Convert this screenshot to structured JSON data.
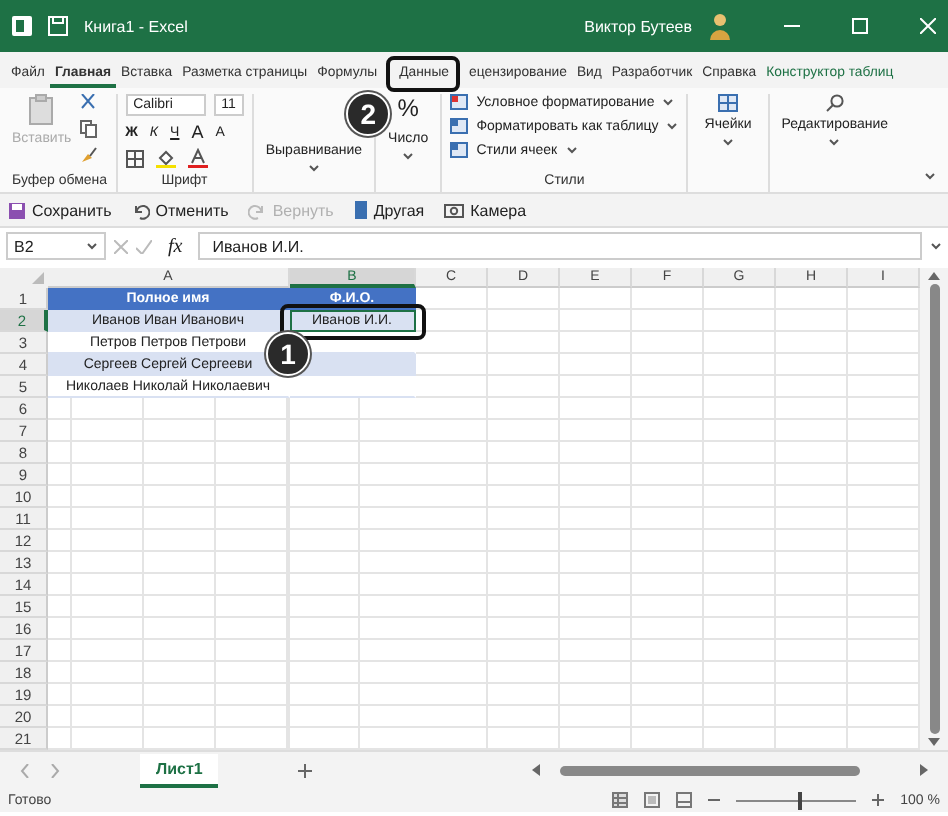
{
  "window": {
    "title": "Книга1 - Excel",
    "user": "Виктор Бутеев"
  },
  "tabs": [
    {
      "label": "Файл",
      "selected": false,
      "highlighted": false
    },
    {
      "label": "Главная",
      "selected": true,
      "highlighted": false
    },
    {
      "label": "Вставка",
      "selected": false,
      "highlighted": false
    },
    {
      "label": "Разметка страницы",
      "selected": false,
      "highlighted": false
    },
    {
      "label": "Формулы",
      "selected": false,
      "highlighted": false
    },
    {
      "label": "Данные",
      "selected": false,
      "highlighted": true,
      "callout": "2"
    },
    {
      "label": "ецензирование",
      "selected": false,
      "highlighted": false
    },
    {
      "label": "Вид",
      "selected": false,
      "highlighted": false
    },
    {
      "label": "Разработчик",
      "selected": false,
      "highlighted": false
    },
    {
      "label": "Справка",
      "selected": false,
      "highlighted": false
    },
    {
      "label": "Конструктор таблиц",
      "selected": false,
      "highlighted": false,
      "kind": "context"
    }
  ],
  "ribbon": {
    "clipboard": {
      "paste": "Вставить",
      "group": "Буфер обмена"
    },
    "font": {
      "name": "Calibri",
      "size": "11",
      "bold": "Ж",
      "italic": "К",
      "underline": "Ч",
      "grow": "A",
      "shrink": "A",
      "group": "Шрифт"
    },
    "alignment": "Выравнивание",
    "number": {
      "symbol": "%",
      "label": "Число"
    },
    "styles": {
      "items": [
        "Условное форматирование",
        "Форматировать как таблицу",
        "Стили ячеек"
      ],
      "group": "Стили"
    },
    "cells": "Ячейки",
    "editing": "Редактирование"
  },
  "quick_access": [
    {
      "label": "Сохранить",
      "disabled": false,
      "kind": "save"
    },
    {
      "label": "Отменить",
      "disabled": false,
      "kind": "undo"
    },
    {
      "label": "Вернуть",
      "disabled": true,
      "kind": "redo"
    },
    {
      "label": "Другая",
      "disabled": false,
      "kind": "other"
    },
    {
      "label": "Камера",
      "disabled": false,
      "kind": "camera"
    }
  ],
  "formula_bar": {
    "cell": "B2",
    "fx": "fx",
    "value": "Иванов И.И."
  },
  "sheet": {
    "columns": [
      {
        "label": "A",
        "selected": false
      },
      {
        "label": "B",
        "selected": true
      },
      {
        "label": "C",
        "selected": false
      },
      {
        "label": "D",
        "selected": false
      },
      {
        "label": "E",
        "selected": false
      },
      {
        "label": "F",
        "selected": false
      },
      {
        "label": "G",
        "selected": false
      },
      {
        "label": "H",
        "selected": false
      },
      {
        "label": "I",
        "selected": false
      }
    ],
    "rows": [
      {
        "number": "1",
        "kind": "header",
        "selected": false,
        "cells": [
          "Полное имя",
          "Ф.И.О."
        ]
      },
      {
        "number": "2",
        "kind": "band",
        "selected": true,
        "callout": "1",
        "cells": [
          "Иванов Иван Иванович",
          "Иванов И.И."
        ]
      },
      {
        "number": "3",
        "kind": "plain",
        "selected": false,
        "cells": [
          "Петров Петров Петрови",
          ""
        ]
      },
      {
        "number": "4",
        "kind": "band",
        "selected": false,
        "cells": [
          "Сергеев Сергей Сергееви",
          ""
        ]
      },
      {
        "number": "5",
        "kind": "plain",
        "selected": false,
        "cells": [
          "Николаев Николай Николаевич",
          ""
        ]
      },
      {
        "number": "6",
        "kind": "empty",
        "selected": false,
        "cells": []
      },
      {
        "number": "7",
        "kind": "empty",
        "selected": false,
        "cells": []
      },
      {
        "number": "8",
        "kind": "empty",
        "selected": false,
        "cells": []
      },
      {
        "number": "9",
        "kind": "empty",
        "selected": false,
        "cells": []
      },
      {
        "number": "10",
        "kind": "empty",
        "selected": false,
        "cells": []
      },
      {
        "number": "11",
        "kind": "empty",
        "selected": false,
        "cells": []
      },
      {
        "number": "12",
        "kind": "empty",
        "selected": false,
        "cells": []
      },
      {
        "number": "13",
        "kind": "empty",
        "selected": false,
        "cells": []
      },
      {
        "number": "14",
        "kind": "empty",
        "selected": false,
        "cells": []
      },
      {
        "number": "15",
        "kind": "empty",
        "selected": false,
        "cells": []
      },
      {
        "number": "16",
        "kind": "empty",
        "selected": false,
        "cells": []
      },
      {
        "number": "17",
        "kind": "empty",
        "selected": false,
        "cells": []
      },
      {
        "number": "18",
        "kind": "empty",
        "selected": false,
        "cells": []
      },
      {
        "number": "19",
        "kind": "empty",
        "selected": false,
        "cells": []
      },
      {
        "number": "20",
        "kind": "empty",
        "selected": false,
        "cells": []
      },
      {
        "number": "21",
        "kind": "empty",
        "selected": false,
        "cells": []
      }
    ]
  },
  "sheet_tabs": [
    {
      "label": "Лист1",
      "selected": true
    }
  ],
  "status_bar": {
    "text": "Готово",
    "zoom": {
      "level": 0.52,
      "reading": "100 %"
    }
  }
}
